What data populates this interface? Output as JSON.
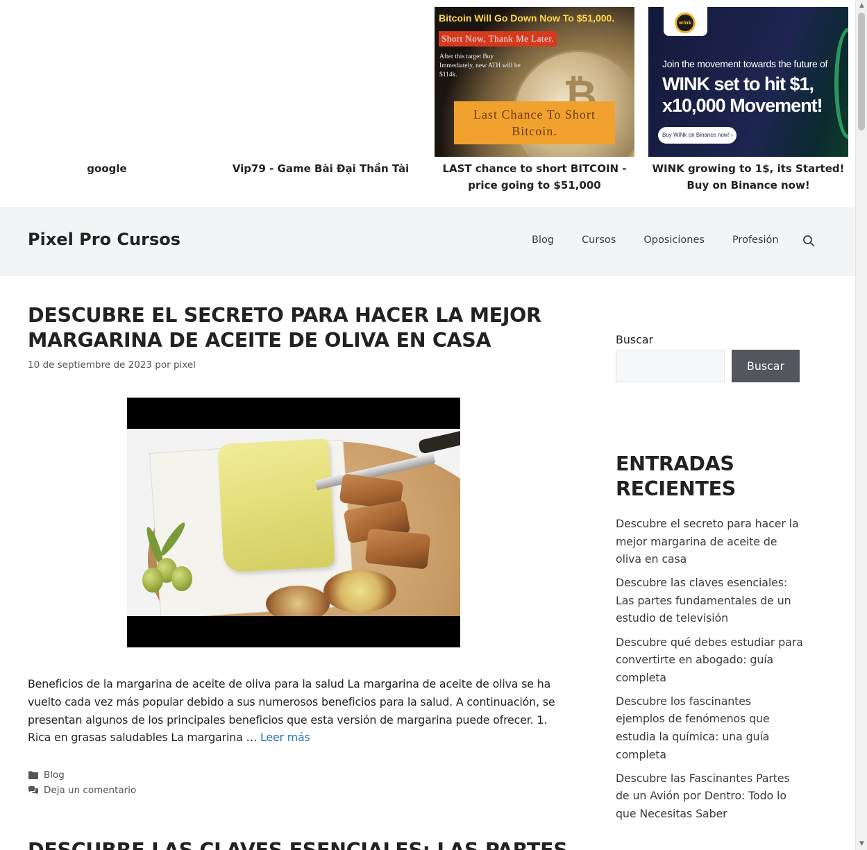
{
  "ads": [
    {
      "caption": "google"
    },
    {
      "caption": "Vip79 - Game Bài Đại Thần Tài"
    },
    {
      "caption": "LAST chance to short BITCOIN - price going to $51,000",
      "image": {
        "line1": "Bitcoin Will Go Down Now To $51,000.",
        "line2": "Short Now, Thank Me Later.",
        "line3": "After this target Buy Immediately, new ATH will be $114k.",
        "banner": "Last Chance To Short Bitcoin."
      }
    },
    {
      "caption": "WINK growing to 1$, its Started! Buy on Binance now!",
      "image": {
        "logo": "wink",
        "sub": "Join the movement towards the future of",
        "big1": "WINK set to hit $1,",
        "big2": "x10,000 Movement!",
        "button": "Buy WINk on Binance now!"
      }
    }
  ],
  "header": {
    "site_title": "Pixel Pro Cursos",
    "nav": [
      "Blog",
      "Cursos",
      "Oposiciones",
      "Profesión"
    ],
    "search_icon": "search-icon"
  },
  "article": {
    "title": "DESCUBRE EL SECRETO PARA HACER LA MEJOR MARGARINA DE ACEITE DE OLIVA EN CASA",
    "date": "10 de septiembre de 2023",
    "by": "por",
    "author": "pixel",
    "excerpt": "Beneficios de la margarina de aceite de oliva para la salud La margarina de aceite de oliva se ha vuelto cada vez más popular debido a sus numerosos beneficios para la salud. A continuación, se presentan algunos de los principales beneficios que esta versión de margarina puede ofrecer. 1. Rica en grasas saludables La margarina …",
    "read_more": "Leer más",
    "category": "Blog",
    "comments": "Deja un comentario"
  },
  "next_article": {
    "title": "DESCUBRE LAS CLAVES ESENCIALES: LAS PARTES"
  },
  "sidebar": {
    "search_label": "Buscar",
    "search_button": "Buscar",
    "recent_heading": "ENTRADAS RECIENTES",
    "recent": [
      "Descubre el secreto para hacer la mejor margarina de aceite de oliva en casa",
      "Descubre las claves esenciales: Las partes fundamentales de un estudio de televisión",
      "Descubre qué debes estudiar para convertirte en abogado: guía completa",
      "Descubre los fascinantes ejemplos de fenómenos que estudia la química: una guía completa",
      "Descubre las Fascinantes Partes de un Avión por Dentro: Todo lo que Necesitas Saber"
    ]
  },
  "colors": {
    "header_bg": "#f3f4f6",
    "link": "#1e73be",
    "button_bg": "#55555e"
  }
}
